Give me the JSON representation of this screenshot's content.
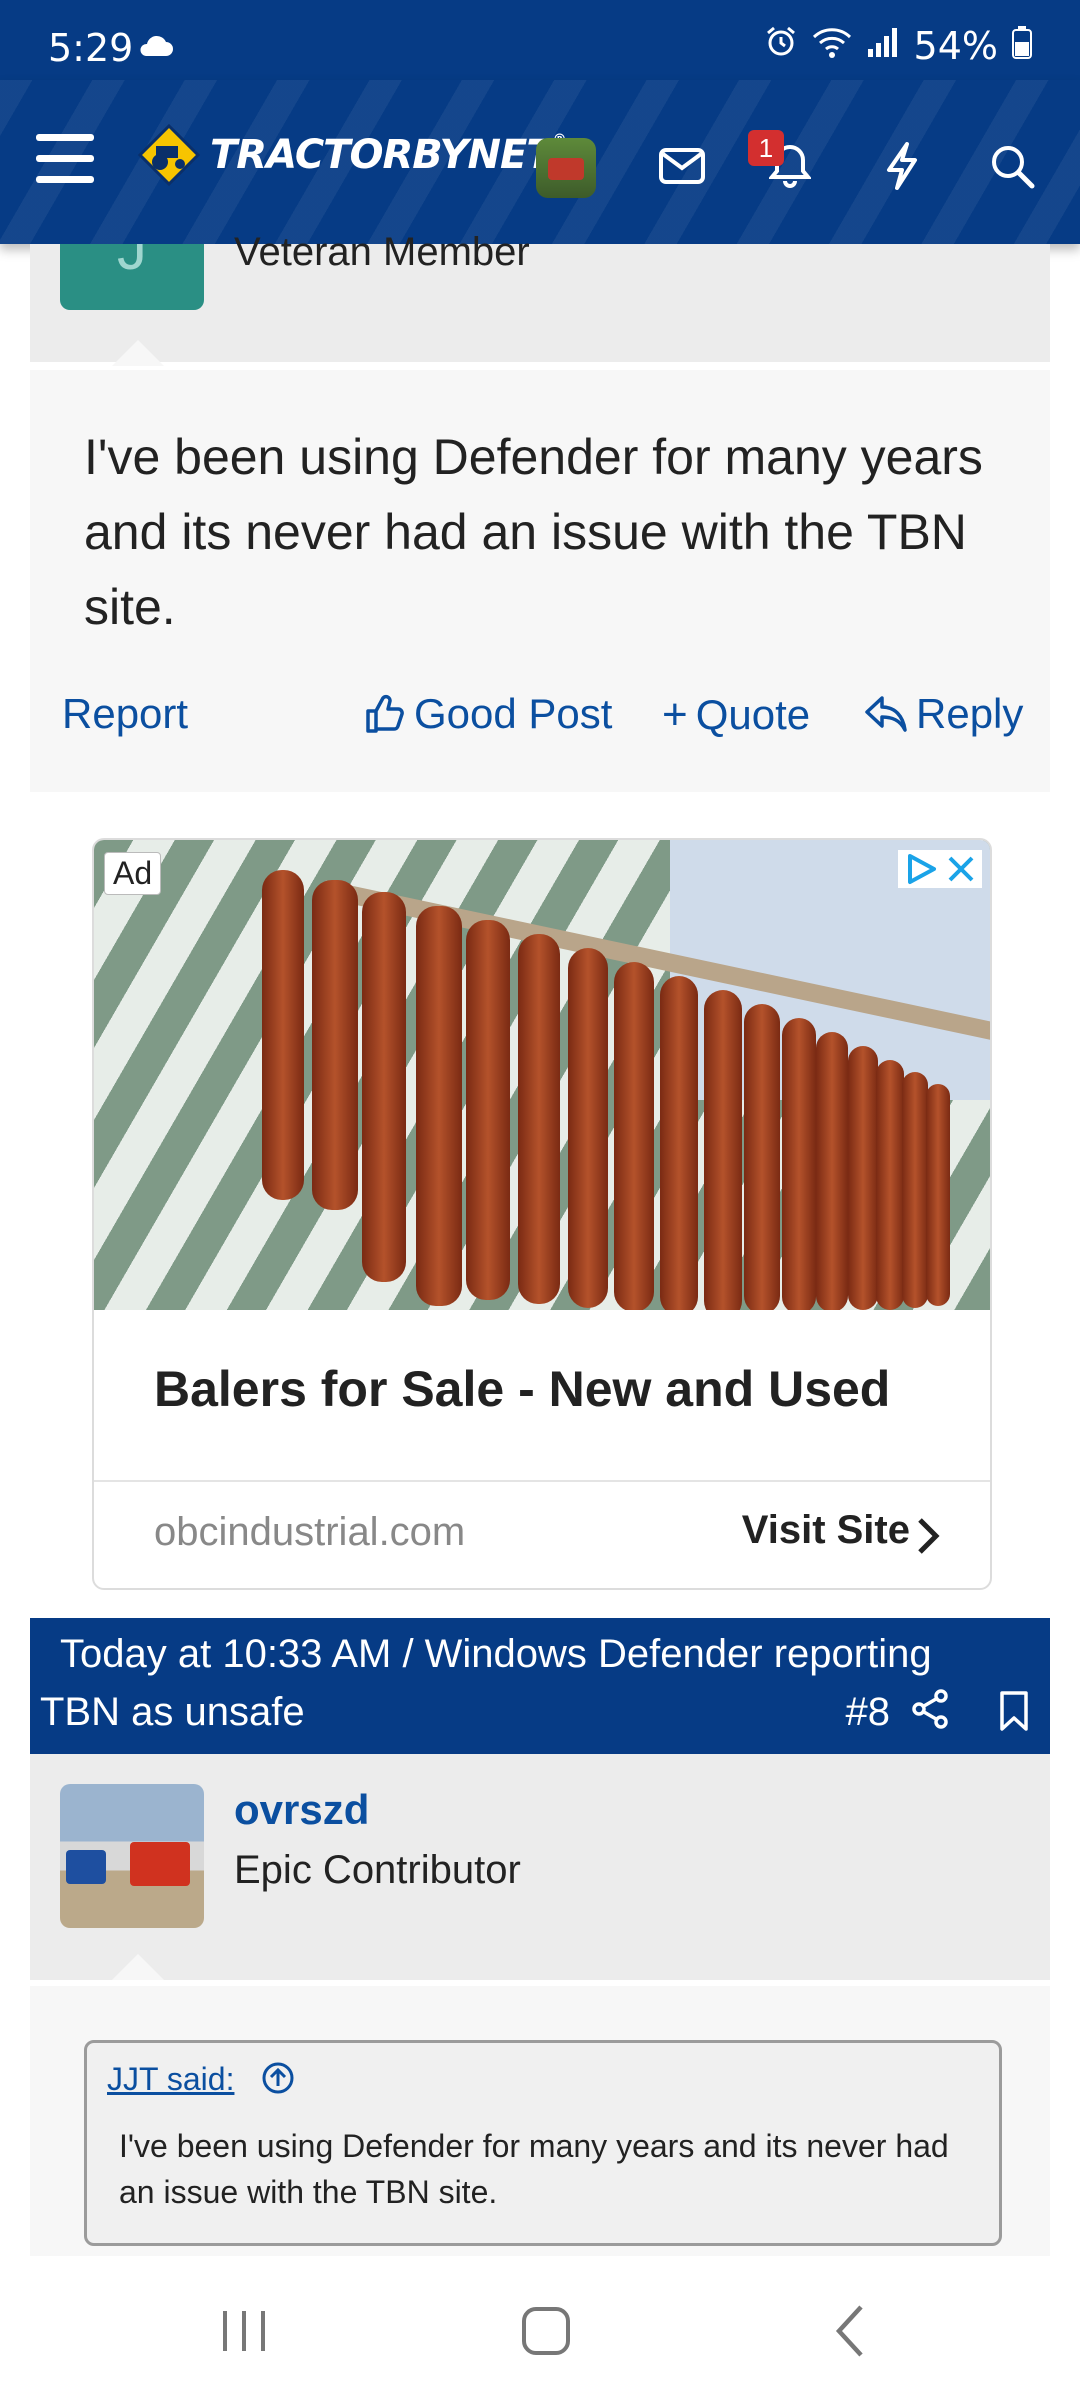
{
  "status_bar": {
    "time": "5:29",
    "battery": "54%"
  },
  "header": {
    "site_name": "TractorByNet",
    "notification_count": "1"
  },
  "prev_post": {
    "member_title": "Veteran Member",
    "avatar_letter": "J",
    "text": "I've been using Defender for many years and its never had an issue with the TBN site.",
    "actions": {
      "report": "Report",
      "good_post": "Good Post",
      "quote": "Quote",
      "reply": "Reply"
    }
  },
  "ad": {
    "badge": "Ad",
    "title": "Balers for Sale - New and Used",
    "domain": "obcindustrial.com",
    "cta": "Visit Site"
  },
  "post_header": {
    "line1": "Today at 10:33 AM / Windows Defender reporting",
    "line2": "TBN as unsafe",
    "number": "#8"
  },
  "post": {
    "username": "ovrszd",
    "user_title": "Epic Contributor",
    "quote_author": "JJT said:",
    "quote_text": "I've been using Defender for many years and its never had an issue with the TBN site."
  },
  "colors": {
    "brand_blue": "#063b85",
    "link_blue": "#0b4fa0",
    "badge_red": "#d32f2f",
    "avatar_teal": "#2a8f84"
  }
}
